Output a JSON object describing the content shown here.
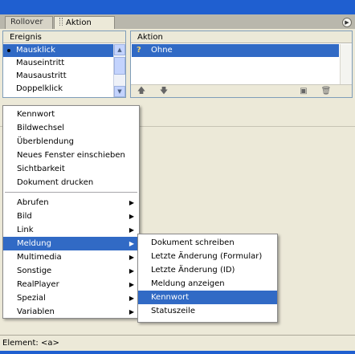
{
  "tabs": [
    {
      "label": "Rollover",
      "active": false
    },
    {
      "label": "Aktion",
      "active": true
    }
  ],
  "event_panel": {
    "header": "Ereignis",
    "items": [
      "Mausklick",
      "Mauseintritt",
      "Mausaustritt",
      "Doppelklick"
    ],
    "selected_index": 0
  },
  "action_panel": {
    "header": "Aktion",
    "items": [
      "Ohne"
    ]
  },
  "context_menu": {
    "group1": [
      "Kennwort",
      "Bildwechsel",
      "Überblendung",
      "Neues Fenster einschieben",
      "Sichtbarkeit",
      "Dokument drucken"
    ],
    "group2": [
      "Abrufen",
      "Bild",
      "Link",
      "Meldung",
      "Multimedia",
      "Sonstige",
      "RealPlayer",
      "Spezial",
      "Variablen"
    ],
    "highlighted": "Meldung"
  },
  "submenu": {
    "items": [
      "Dokument schreiben",
      "Letzte Änderung (Formular)",
      "Letzte Änderung (ID)",
      "Meldung anzeigen",
      "Kennwort",
      "Statuszeile"
    ],
    "highlighted": "Kennwort"
  },
  "status": {
    "text": "Element: <a>"
  },
  "colors": {
    "selection": "#316ac5",
    "titlebar": "#1f5fd0",
    "panel_bg": "#ece9d8"
  }
}
